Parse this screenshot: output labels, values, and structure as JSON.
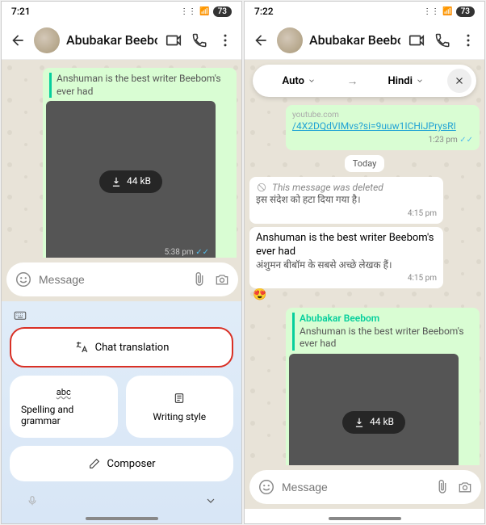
{
  "left": {
    "status": {
      "time": "7:21",
      "battery": "73"
    },
    "contact": "Abubakar Beebom",
    "quoteText": "Anshuman is the best writer Beebom's ever had",
    "media": {
      "size": "44 kB",
      "time": "5:38 pm"
    },
    "input": {
      "placeholder": "Message",
      "value": ""
    },
    "kb": {
      "translate": "Chat translation",
      "spelling": "Spelling and grammar",
      "spellingSub": "abc",
      "writing": "Writing style",
      "composer": "Composer"
    }
  },
  "right": {
    "status": {
      "time": "7:22",
      "battery": "73"
    },
    "contact": "Abubakar Beebom",
    "translate": {
      "from": "Auto",
      "to": "Hindi"
    },
    "linkSub": "youtube.com",
    "linkFrag": "/4X2DQdVIMvs?si=9uuw1ICHiJPrysRI",
    "linkTime": "1:23 pm",
    "dateChip": "Today",
    "deleted": {
      "en": "This message was deleted",
      "hi": "इस संदेश को हटा दिया गया है।",
      "time": "4:15 pm"
    },
    "msg": {
      "en": "Anshuman is the best writer Beebom's ever had",
      "hi": "अंशुमन बीबॉम के सबसे अच्छे लेखक हैं।",
      "time": "4:15 pm"
    },
    "react": "😍",
    "reply": {
      "name": "Abubakar Beebom",
      "quote": "Anshuman is the best writer Beebom's ever had",
      "size": "44 kB"
    },
    "input": {
      "placeholder": "Message"
    }
  }
}
